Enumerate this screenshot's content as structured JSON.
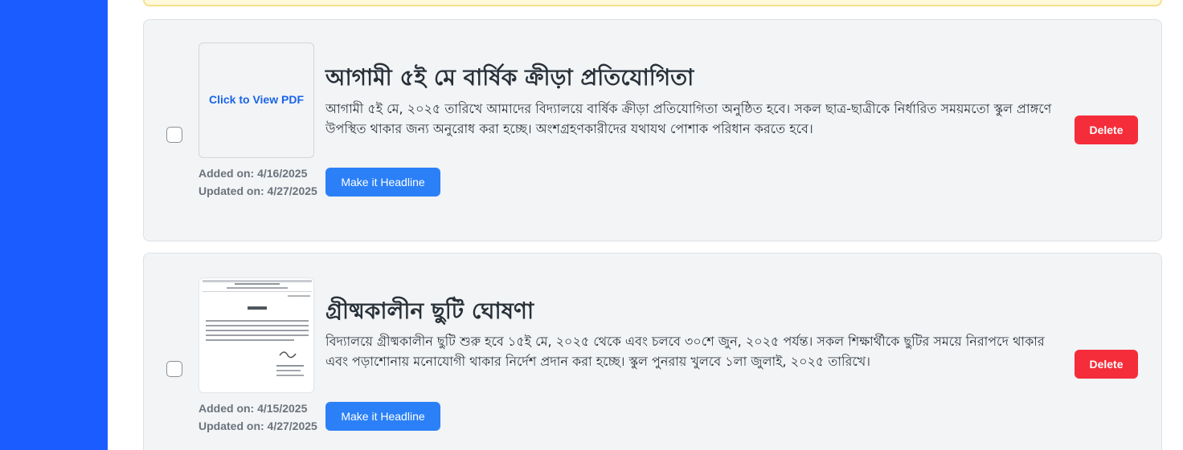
{
  "notices": [
    {
      "thumbnail": {
        "type": "pdf-link",
        "label": "Click to View PDF"
      },
      "title": "আগামী ৫ই মে বার্ষিক ক্রীড়া প্রতিযোগিতা",
      "description": "আগামী ৫ই মে, ২০২৫ তারিখে আমাদের বিদ্যালয়ে বার্ষিক ক্রীড়া প্রতিযোগিতা অনুষ্ঠিত হবে। সকল ছাত্র-ছাত্রীকে নির্ধারিত সময়মতো স্কুল প্রাঙ্গণে উপস্থিত থাকার জন্য অনুরোধ করা হচ্ছে। অংশগ্রহণকারীদের যথাযথ পোশাক পরিধান করতে হবে।",
      "added": "Added on: 4/16/2025",
      "updated": "Updated on: 4/27/2025",
      "headline_label": "Make it Headline",
      "delete_label": "Delete"
    },
    {
      "thumbnail": {
        "type": "image",
        "icon": "document-image"
      },
      "title": "গ্রীষ্মকালীন ছুটি ঘোষণা",
      "description": "বিদ্যালয়ে গ্রীষ্মকালীন ছুটি শুরু হবে ১৫ই মে, ২০২৫ থেকে এবং চলবে ৩০শে জুন, ২০২৫ পর্যন্ত। সকল শিক্ষার্থীকে ছুটির সময়ে নিরাপদে থাকার এবং পড়াশোনায় মনোযোগী থাকার নির্দেশ প্রদান করা হচ্ছে। স্কুল পুনরায় খুলবে ১লা জুলাই, ২০২৫ তারিখে।",
      "added": "Added on: 4/15/2025",
      "updated": "Updated on: 4/27/2025",
      "headline_label": "Make it Headline",
      "delete_label": "Delete"
    }
  ],
  "colors": {
    "sidebar": "#1a5cff",
    "card_bg": "#f2f4f6",
    "headline_button": "#2b80f7",
    "delete_button": "#f52d3a",
    "pdf_link": "#1a64e6",
    "alert_strip": "#fff9db"
  }
}
